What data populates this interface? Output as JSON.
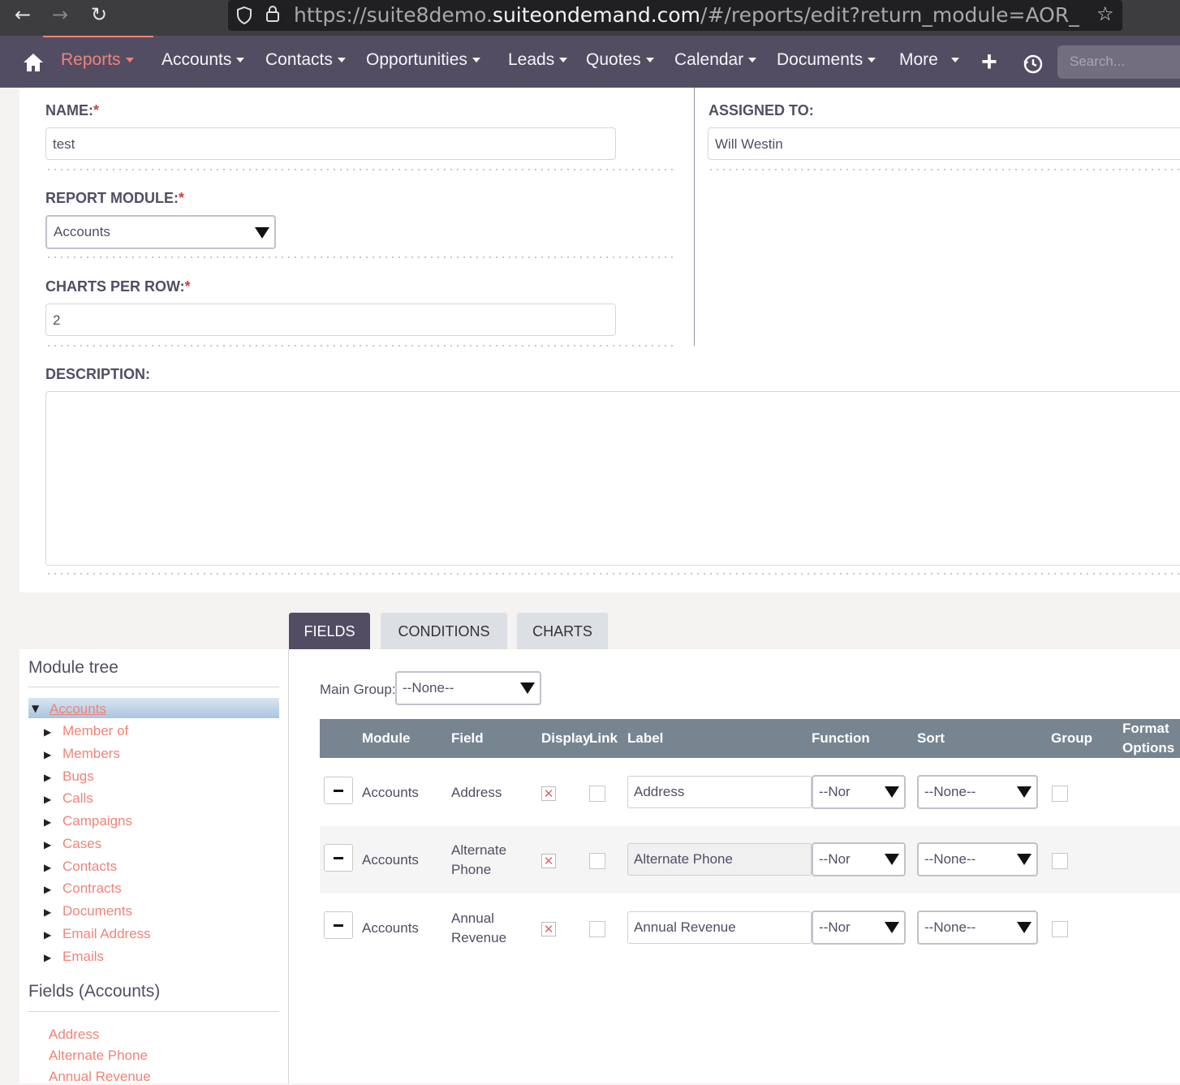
{
  "browser": {
    "back_icon": "arrow-left-icon",
    "forward_icon": "arrow-right-icon",
    "reload_icon": "reload-icon",
    "url_prefix": "https://suite8demo.",
    "url_domain": "suiteondemand.com",
    "url_path": "/#/reports/edit?return_module=AOR_Rep"
  },
  "nav": {
    "items": [
      "Reports",
      "Accounts",
      "Contacts",
      "Opportunities",
      "Leads",
      "Quotes",
      "Calendar",
      "Documents",
      "More"
    ],
    "active": "Reports",
    "search_placeholder": "Search..."
  },
  "form": {
    "name_label": "NAME:",
    "name_value": "test",
    "assigned_label": "ASSIGNED TO:",
    "assigned_value": "Will Westin",
    "report_module_label": "REPORT MODULE:",
    "report_module_value": "Accounts",
    "charts_per_row_label": "CHARTS PER ROW:",
    "charts_per_row_value": "2",
    "description_label": "DESCRIPTION:",
    "required_mark": "*"
  },
  "tabs": [
    "FIELDS",
    "CONDITIONS",
    "CHARTS"
  ],
  "sidebar": {
    "module_tree_title": "Module tree",
    "root": "Accounts",
    "children": [
      "Member of",
      "Members",
      "Bugs",
      "Calls",
      "Campaigns",
      "Cases",
      "Contacts",
      "Contracts",
      "Documents",
      "Email Address",
      "Emails"
    ],
    "fields_title": "Fields (Accounts)",
    "fields": [
      "Address",
      "Alternate Phone",
      "Annual Revenue"
    ]
  },
  "fields_panel": {
    "main_group_label": "Main Group:",
    "main_group_value": "--None--",
    "headers": {
      "module": "Module",
      "field": "Field",
      "display": "Display",
      "link": "Link",
      "label": "Label",
      "function": "Function",
      "sort": "Sort",
      "group": "Group",
      "format_1": "Format",
      "format_2": "Options"
    },
    "rows": [
      {
        "module": "Accounts",
        "field_1": "Address",
        "field_2": "",
        "label": "Address",
        "function": "--Nor",
        "sort": "--None--"
      },
      {
        "module": "Accounts",
        "field_1": "Alternate",
        "field_2": "Phone",
        "label": "Alternate Phone",
        "function": "--Nor",
        "sort": "--None--"
      },
      {
        "module": "Accounts",
        "field_1": "Annual",
        "field_2": "Revenue",
        "label": "Annual Revenue",
        "function": "--Nor",
        "sort": "--None--"
      }
    ],
    "display_mark": "✕"
  },
  "colors": {
    "nav_bg": "#534d64",
    "accent": "#f08377",
    "table_header": "#778591",
    "required": "#ce4245"
  }
}
